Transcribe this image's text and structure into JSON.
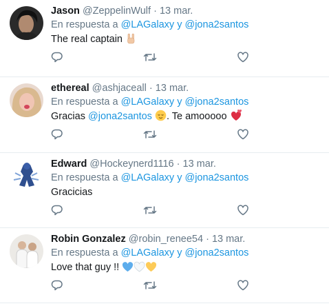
{
  "tweets": [
    {
      "name": "Jason",
      "handle": "@ZeppelinWulf",
      "separator": "·",
      "time": "13 mar.",
      "reply_prefix": "En respuesta a",
      "reply_to_1": "@LAGalaxy",
      "reply_join": "y",
      "reply_to_2": "@jona2santos",
      "text": "The real captain",
      "emojis": [
        "sign-of-horns-icon"
      ]
    },
    {
      "name": "ethereal",
      "handle": "@ashjaceall",
      "separator": "·",
      "time": "13 mar.",
      "reply_prefix": "En respuesta a",
      "reply_to_1": "@LAGalaxy",
      "reply_join": "y",
      "reply_to_2": "@jona2santos",
      "text_before": "Gracias",
      "text_mention": "@jona2santos",
      "text_after": ". Te amooooo",
      "emojis": [
        "relieved-face-icon",
        "revolving-hearts-icon"
      ]
    },
    {
      "name": "Edward",
      "handle": "@Hockeynerd1116",
      "separator": "·",
      "time": "13 mar.",
      "reply_prefix": "En respuesta a",
      "reply_to_1": "@LAGalaxy",
      "reply_join": "y",
      "reply_to_2": "@jona2santos",
      "text": "Gracicias",
      "emojis": []
    },
    {
      "name": "Robin Gonzalez",
      "handle": "@robin_renee54",
      "separator": "·",
      "time": "13 mar.",
      "reply_prefix": "En respuesta a",
      "reply_to_1": "@LAGalaxy",
      "reply_join": "y",
      "reply_to_2": "@jona2santos",
      "text": "Love that guy !!",
      "emojis": [
        "blue-heart-icon",
        "white-heart-icon",
        "yellow-heart-icon"
      ]
    }
  ],
  "colors": {
    "link": "#1b95e0",
    "muted": "#657786",
    "text": "#14171a",
    "divider": "#e6ecf0"
  },
  "icons": [
    "reply-icon",
    "retweet-icon",
    "like-icon"
  ]
}
